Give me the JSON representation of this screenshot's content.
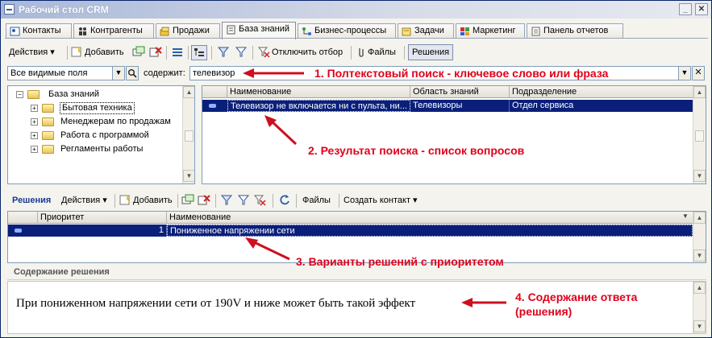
{
  "window": {
    "title": "Рабочий стол CRM"
  },
  "tabs": [
    {
      "label": "Контакты",
      "icon": "contacts-icon"
    },
    {
      "label": "Контрагенты",
      "icon": "counterparties-icon"
    },
    {
      "label": "Продажи",
      "icon": "sales-icon"
    },
    {
      "label": "База знаний",
      "icon": "knowledge-base-icon",
      "active": true
    },
    {
      "label": "Бизнес-процессы",
      "icon": "business-process-icon"
    },
    {
      "label": "Задачи",
      "icon": "tasks-icon"
    },
    {
      "label": "Маркетинг",
      "icon": "marketing-icon"
    },
    {
      "label": "Панель отчетов",
      "icon": "reports-icon"
    }
  ],
  "toolbar": {
    "actions_label": "Действия",
    "add_label": "Добавить",
    "disable_filter_label": "Отключить отбор",
    "files_label": "Файлы",
    "solutions_label": "Решения"
  },
  "search": {
    "field_scope": "Все видимые поля",
    "contains_label": "содержит:",
    "query": "телевизор"
  },
  "tree": {
    "root": "База знаний",
    "items": [
      "Бытовая техника",
      "Менеджерам по продажам",
      "Работа с программой",
      "Регламенты работы"
    ]
  },
  "questions": {
    "columns": [
      "Наименование",
      "Область знаний",
      "Подразделение"
    ],
    "rows": [
      [
        "Телевизор не включается ни с пульта, ни...",
        "Телевизоры",
        "Отдел сервиса"
      ]
    ]
  },
  "solutions_toolbar": {
    "title": "Решения",
    "actions_label": "Действия",
    "add_label": "Добавить",
    "files_label": "Файлы",
    "create_contact_label": "Создать контакт"
  },
  "solutions": {
    "columns": [
      "Приоритет",
      "Наименование"
    ],
    "rows": [
      [
        "1",
        "Пониженное напряжении сети"
      ]
    ]
  },
  "content": {
    "title": "Содержание решения",
    "text": "При пониженном напряжении сети от 190V и ниже может быть такой эффект"
  },
  "annotations": {
    "a1": "1. Полтекстовый поиск - ключевое слово или фраза",
    "a2": "2. Результат поиска - список вопросов",
    "a3": "3. Варианты решений с приоритетом",
    "a4_line1": "4. Содержание ответа",
    "a4_line2": "(решения)"
  },
  "colors": {
    "selection": "#0a1f7a",
    "annotation": "#e0001b"
  }
}
